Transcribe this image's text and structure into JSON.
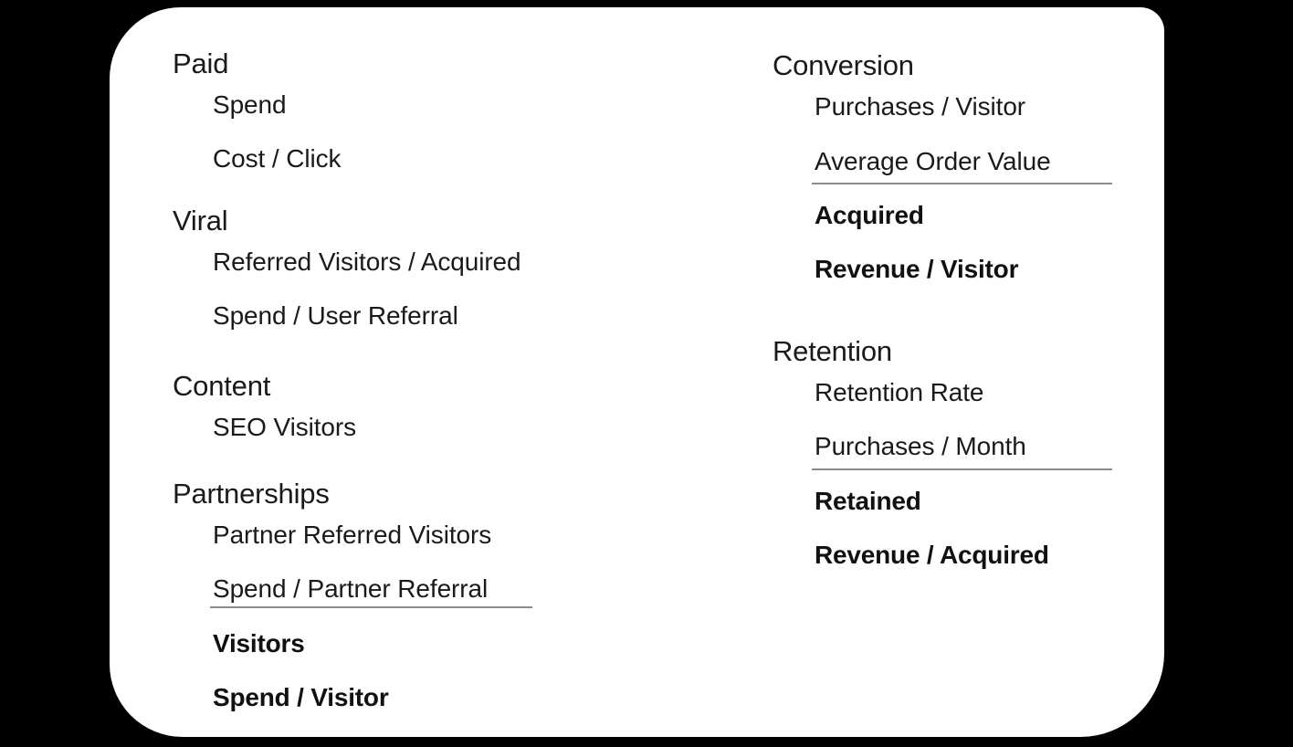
{
  "theme": {
    "page_background": "#000000",
    "card_background": "#ffffff",
    "text_color": "#1a1a1a",
    "bold_text_color": "#111111",
    "rule_color": "#8c8c8c"
  },
  "left_column": {
    "groups": [
      {
        "heading": "Paid",
        "items": [
          {
            "label": "Spend",
            "bold": false
          },
          {
            "label": "Cost / Click",
            "bold": false
          }
        ]
      },
      {
        "heading": "Viral",
        "items": [
          {
            "label": "Referred Visitors / Acquired",
            "bold": false
          },
          {
            "label": "Spend / User Referral",
            "bold": false
          }
        ]
      },
      {
        "heading": "Content",
        "items": [
          {
            "label": "SEO Visitors",
            "bold": false
          }
        ]
      },
      {
        "heading": "Partnerships",
        "items": [
          {
            "label": "Partner Referred Visitors",
            "bold": false
          },
          {
            "label": "Spend / Partner Referral",
            "bold": false
          }
        ],
        "has_rule": true,
        "totals": [
          {
            "label": "Visitors",
            "bold": true
          },
          {
            "label": "Spend / Visitor",
            "bold": true
          }
        ]
      }
    ]
  },
  "right_column": {
    "groups": [
      {
        "heading": "Conversion",
        "items": [
          {
            "label": "Purchases / Visitor",
            "bold": false
          },
          {
            "label": "Average Order Value",
            "bold": false
          }
        ],
        "has_rule": true,
        "totals": [
          {
            "label": "Acquired",
            "bold": true
          },
          {
            "label": "Revenue / Visitor",
            "bold": true
          }
        ]
      },
      {
        "heading": "Retention",
        "items": [
          {
            "label": "Retention Rate",
            "bold": false
          },
          {
            "label": "Purchases / Month",
            "bold": false
          }
        ],
        "has_rule": true,
        "totals": [
          {
            "label": "Retained",
            "bold": true
          },
          {
            "label": "Revenue / Acquired",
            "bold": true
          }
        ]
      }
    ]
  }
}
